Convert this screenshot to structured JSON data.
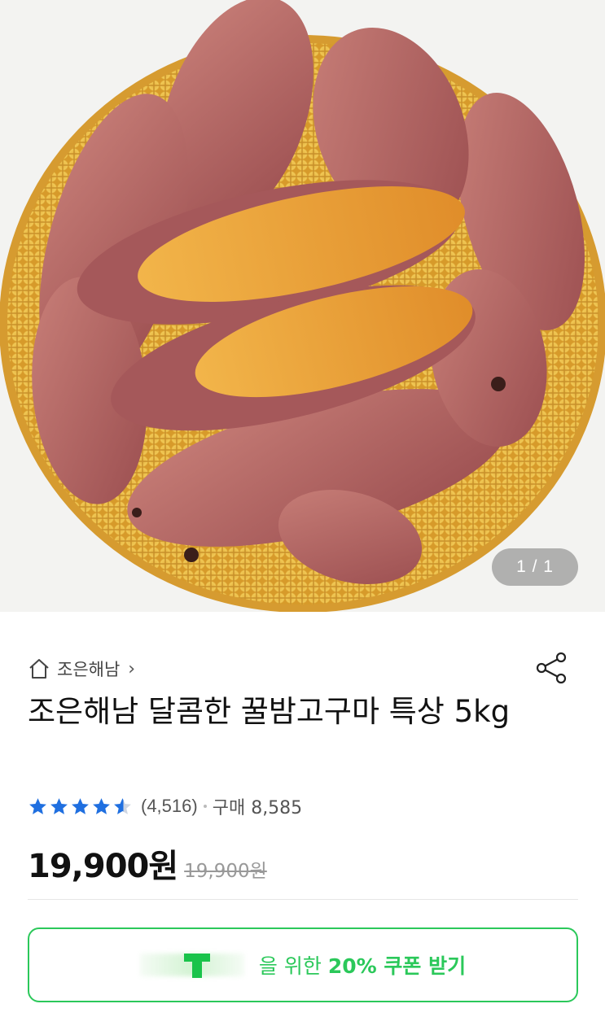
{
  "gallery": {
    "image_alt": "roasted sweet potatoes in bamboo basket",
    "counter": "1 / 1"
  },
  "store": {
    "name": "조은해남",
    "chevron": "›"
  },
  "product": {
    "title": "조은해남 달콤한 꿀밤고구마  특상 5kg"
  },
  "rating": {
    "stars": 4.5,
    "review_count": "(4,516)",
    "purchase_label": "구매 8,585"
  },
  "price": {
    "current": "19,900원",
    "original": "19,900원"
  },
  "coupon": {
    "text_prefix": "을 위한 ",
    "text_highlight": "20% 쿠폰 받기"
  },
  "colors": {
    "accent_green": "#2bc85a",
    "star_blue": "#1f6fe0"
  },
  "icons": {
    "home": "home-icon",
    "share": "share-icon",
    "star": "star-icon"
  }
}
